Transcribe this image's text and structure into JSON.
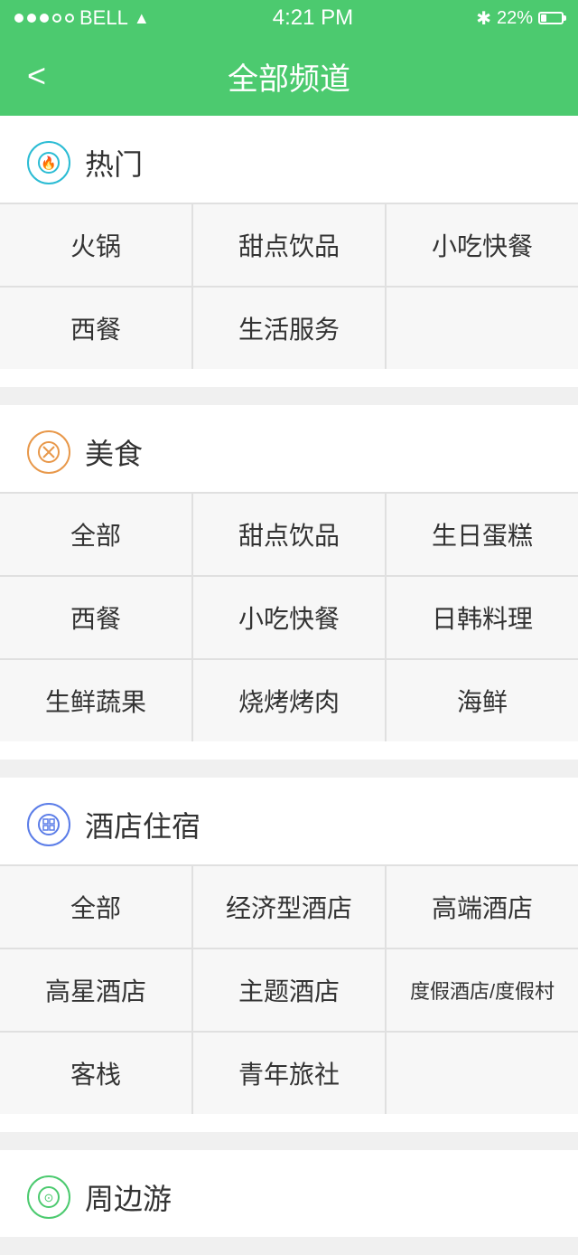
{
  "statusBar": {
    "carrier": "BELL",
    "time": "4:21 PM",
    "battery": "22%"
  },
  "header": {
    "title": "全部频道",
    "backLabel": "<"
  },
  "sections": [
    {
      "id": "hot",
      "iconType": "hot",
      "iconSymbol": "🔥",
      "title": "热门",
      "items": [
        "火锅",
        "甜点饮品",
        "小吃快餐",
        "西餐",
        "生活服务",
        ""
      ]
    },
    {
      "id": "food",
      "iconType": "food",
      "iconSymbol": "✕",
      "title": "美食",
      "items": [
        "全部",
        "甜点饮品",
        "生日蛋糕",
        "西餐",
        "小吃快餐",
        "日韩料理",
        "生鲜蔬果",
        "烧烤烤肉",
        "海鲜"
      ]
    },
    {
      "id": "hotel",
      "iconType": "hotel",
      "iconSymbol": "⊞",
      "title": "酒店住宿",
      "items": [
        "全部",
        "经济型酒店",
        "高端酒店",
        "高星酒店",
        "主题酒店",
        "度假酒店/度假村",
        "客栈",
        "青年旅社",
        ""
      ]
    },
    {
      "id": "travel",
      "iconType": "travel",
      "iconSymbol": "🚗",
      "title": "周边游",
      "items": []
    }
  ]
}
